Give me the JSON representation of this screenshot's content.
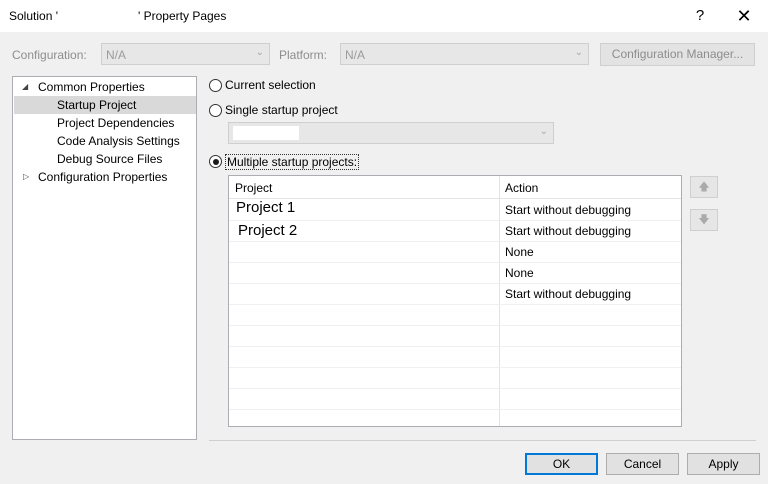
{
  "window": {
    "title": "Solution '                        ' Property Pages",
    "help_glyph": "?",
    "close_glyph": "✕"
  },
  "config_row": {
    "configuration_label": "Configuration:",
    "configuration_value": "N/A",
    "platform_label": "Platform:",
    "platform_value": "N/A",
    "manager_button": "Configuration Manager..."
  },
  "tree": {
    "root_label": "Common Properties",
    "children": [
      "Startup Project",
      "Project Dependencies",
      "Code Analysis Settings",
      "Debug Source Files"
    ],
    "selected": "Startup Project",
    "collapsed_label": "Configuration Properties"
  },
  "radios": {
    "current_selection": "Current selection",
    "single_startup": "Single startup project",
    "multiple_startup": "Multiple startup projects:",
    "checked": "multiple_startup"
  },
  "grid": {
    "col_project": "Project",
    "col_action": "Action",
    "rows": [
      {
        "project": "Project 1",
        "action": "Start without debugging"
      },
      {
        "project": "Project 2",
        "action": "Start without debugging"
      },
      {
        "project": "",
        "action": "None"
      },
      {
        "project": "",
        "action": "None"
      },
      {
        "project": "",
        "action": "Start without debugging"
      },
      {
        "project": "",
        "action": ""
      },
      {
        "project": "",
        "action": ""
      },
      {
        "project": "",
        "action": ""
      },
      {
        "project": "",
        "action": ""
      },
      {
        "project": "",
        "action": ""
      }
    ]
  },
  "move_buttons": {
    "up_glyph": "🡅",
    "down_glyph": "🡇"
  },
  "buttons": {
    "ok": "OK",
    "cancel": "Cancel",
    "apply": "Apply"
  },
  "colors": {
    "default_button_border": "#0078d7",
    "selection_bg": "#d9d9d9"
  }
}
